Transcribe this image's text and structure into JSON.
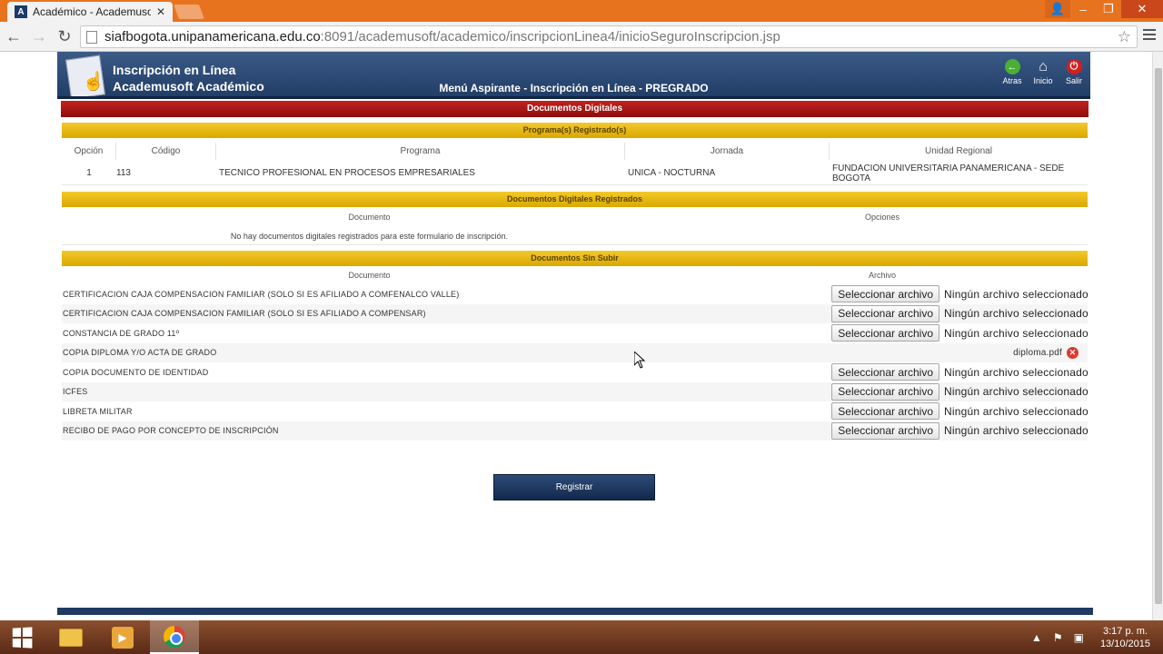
{
  "browser": {
    "tab_title": "Académico - Academusof",
    "tab_favicon": "A",
    "url_host": "siafbogota.unipanamericana.edu.co",
    "url_path": ":8091/academusoft/academico/inscripcionLinea4/inicioSeguroInscripcion.jsp"
  },
  "header": {
    "title_line1": "Inscripción en Línea",
    "title_line2": "Academusoft Académico",
    "menu_title": "Menú Aspirante - Inscripción en Línea - PREGRADO",
    "links": {
      "back": "Atras",
      "home": "Inicio",
      "exit": "Salir"
    }
  },
  "sections": {
    "digital_docs": "Documentos Digitales",
    "programs": "Programa(s) Registrado(s)",
    "registered_docs": "Documentos Digitales Registrados",
    "pending_docs": "Documentos Sin Subir"
  },
  "programs_table": {
    "headers": [
      "Opción",
      "Código",
      "Programa",
      "Jornada",
      "Unidad Regional"
    ],
    "rows": [
      [
        "1",
        "113",
        "TECNICO PROFESIONAL EN PROCESOS EMPRESARIALES",
        "UNICA - NOCTURNA",
        "FUNDACION UNIVERSITARIA PANAMERICANA - SEDE BOGOTA"
      ]
    ]
  },
  "registered_table": {
    "headers": [
      "Documento",
      "Opciones"
    ],
    "empty_message": "No hay documentos digitales registrados para este formulario de inscripción."
  },
  "pending_table": {
    "headers": [
      "Documento",
      "Archivo"
    ],
    "select_label": "Seleccionar archivo",
    "no_file_label": "Ningún archivo seleccionado",
    "rows": [
      {
        "name": "CERTIFICACION CAJA COMPENSACION FAMILIAR (SOLO SI ES AFILIADO A COMFENALCO VALLE)",
        "file": ""
      },
      {
        "name": "CERTIFICACION CAJA COMPENSACION FAMILIAR (SOLO SI ES AFILIADO A COMPENSAR)",
        "file": ""
      },
      {
        "name": "CONSTANCIA DE GRADO 11º",
        "file": ""
      },
      {
        "name": "COPIA DIPLOMA Y/O ACTA DE GRADO",
        "file": "diploma.pdf"
      },
      {
        "name": "COPIA DOCUMENTO DE IDENTIDAD",
        "file": ""
      },
      {
        "name": "ICFES",
        "file": ""
      },
      {
        "name": "LIBRETA MILITAR",
        "file": ""
      },
      {
        "name": "RECIBO DE PAGO POR CONCEPTO DE INSCRIPCIÓN",
        "file": ""
      }
    ]
  },
  "register_button": "Registrar",
  "taskbar": {
    "time": "3:17 p. m.",
    "date": "13/10/2015"
  },
  "colors": {
    "header_blue": "#203d66",
    "section_red": "#a8171a",
    "section_yellow": "#e8b90f",
    "tab_orange": "#e8731f"
  }
}
